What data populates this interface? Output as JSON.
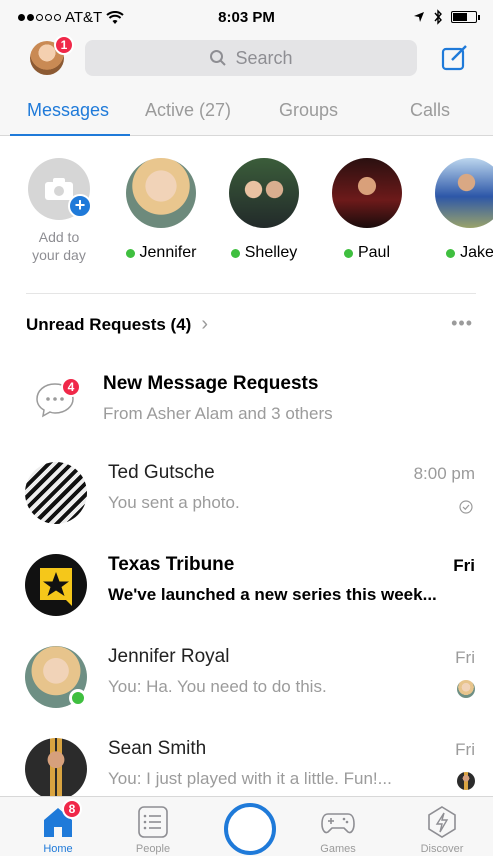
{
  "status_bar": {
    "carrier": "AT&T",
    "time": "8:03 PM"
  },
  "header": {
    "profile_badge": "1",
    "search_placeholder": "Search"
  },
  "tabs": [
    {
      "label": "Messages",
      "active": true
    },
    {
      "label": "Active (27)"
    },
    {
      "label": "Groups"
    },
    {
      "label": "Calls"
    }
  ],
  "stories": {
    "add_caption_1": "Add to",
    "add_caption_2": "your day",
    "people": [
      {
        "name": "Jennifer",
        "online": true
      },
      {
        "name": "Shelley",
        "online": true
      },
      {
        "name": "Paul",
        "online": true
      },
      {
        "name": "Jake",
        "online": true
      }
    ]
  },
  "unread_requests": {
    "label": "Unread Requests (4)",
    "more": "•••"
  },
  "message_requests": {
    "badge": "4",
    "title": "New Message Requests",
    "subtitle": "From Asher Alam and 3 others"
  },
  "conversations": [
    {
      "name": "Ted Gutsche",
      "preview": "You sent a photo.",
      "time": "8:00 pm",
      "unread": false
    },
    {
      "name": "Texas Tribune",
      "preview": "We've launched a new series this week...",
      "time": "Fri",
      "unread": true
    },
    {
      "name": "Jennifer Royal",
      "preview": "You: Ha. You need to do this.",
      "time": "Fri",
      "unread": false
    },
    {
      "name": "Sean Smith",
      "preview": "You: I just played with it a little. Fun!...",
      "time": "Fri",
      "unread": false
    }
  ],
  "tab_bar": {
    "home": "Home",
    "home_badge": "8",
    "people": "People",
    "games": "Games",
    "discover": "Discover"
  },
  "colors": {
    "accent": "#1f7ad9",
    "badge": "#f02849",
    "online": "#3fbf3f"
  }
}
